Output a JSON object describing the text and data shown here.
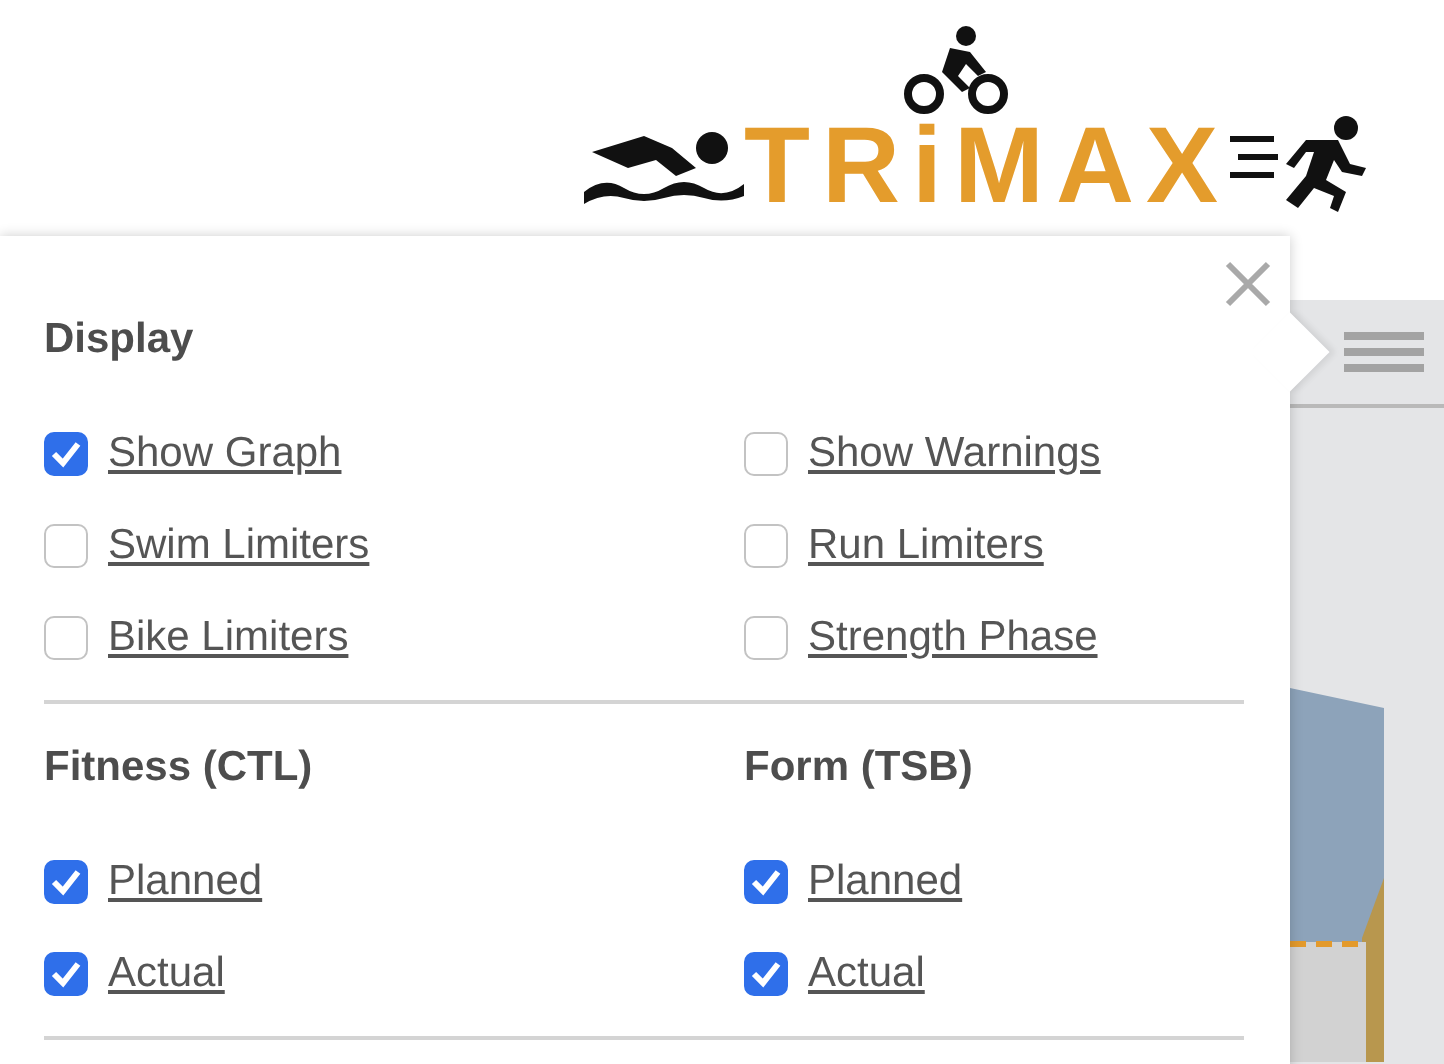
{
  "logo": {
    "text": "TRiMAX"
  },
  "options_panel": {
    "sections": [
      {
        "columns": [
          {
            "heading": "Display",
            "items": [
              {
                "label": "Show Graph",
                "checked": true
              },
              {
                "label": "Swim Limiters",
                "checked": false
              },
              {
                "label": "Bike Limiters",
                "checked": false
              }
            ]
          },
          {
            "items": [
              {
                "label": "Show Warnings",
                "checked": false
              },
              {
                "label": "Run Limiters",
                "checked": false
              },
              {
                "label": "Strength Phase",
                "checked": false
              }
            ]
          }
        ]
      },
      {
        "columns": [
          {
            "heading": "Fitness (CTL)",
            "items": [
              {
                "label": "Planned",
                "checked": true
              },
              {
                "label": "Actual",
                "checked": true
              }
            ]
          },
          {
            "heading": "Form (TSB)",
            "items": [
              {
                "label": "Planned",
                "checked": true
              },
              {
                "label": "Actual",
                "checked": true
              }
            ]
          }
        ]
      }
    ]
  }
}
